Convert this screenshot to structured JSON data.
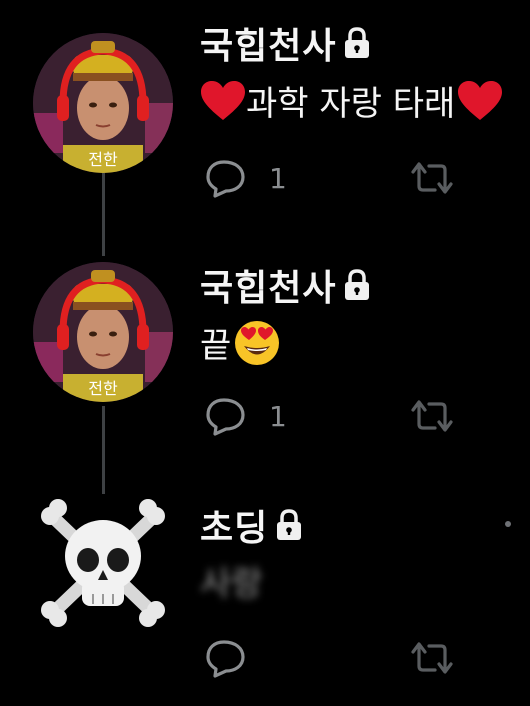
{
  "thread": [
    {
      "author": "국힙천사",
      "locked": true,
      "text": "과학 자랑 타래",
      "avatar_label": "전한",
      "reply_count": "1"
    },
    {
      "author": "국힙천사",
      "locked": true,
      "text": "끝",
      "avatar_label": "전한",
      "reply_count": "1"
    },
    {
      "author": "초딩",
      "locked": true,
      "text": "사랑",
      "reply_count": ""
    }
  ],
  "icons": {
    "lock": "lock-icon",
    "reply": "reply-icon",
    "retweet": "retweet-icon",
    "heart": "red-heart-emoji",
    "heart_eyes": "heart-eyes-emoji",
    "skull": "skull-and-crossbones-emoji"
  },
  "colors": {
    "background": "#000000",
    "text": "#e7e9ea",
    "muted": "#8b8e91",
    "heart": "#e0162b",
    "thread_line": "#3e4144"
  }
}
